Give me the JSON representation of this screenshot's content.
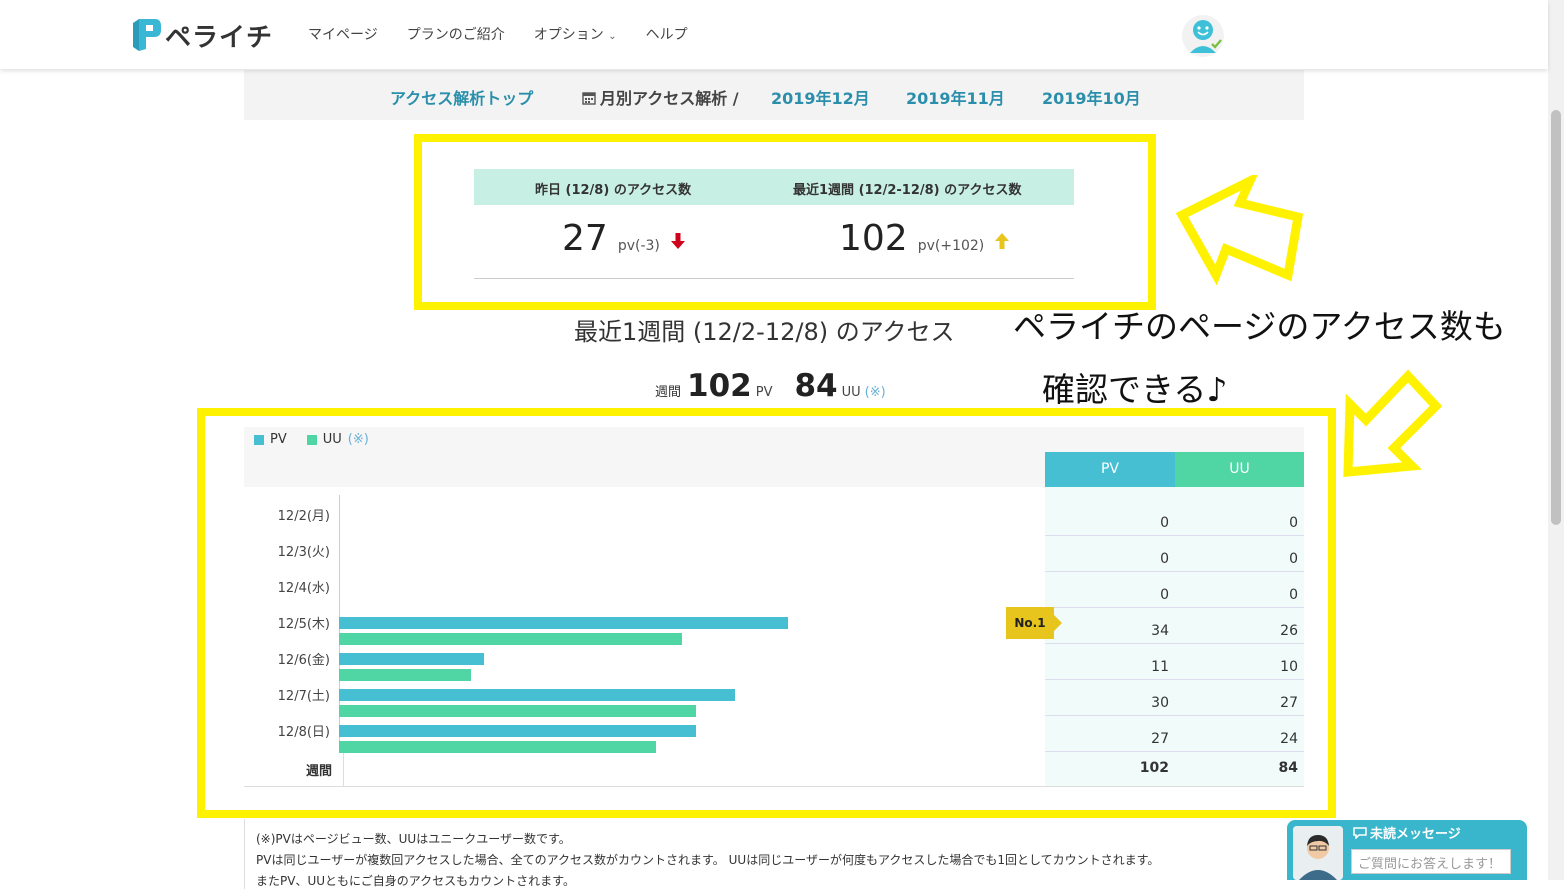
{
  "header": {
    "logo_text": "ペライチ",
    "nav": [
      "マイページ",
      "プランのご紹介",
      "オプション",
      "ヘルプ"
    ],
    "nav_chevron": "⌄"
  },
  "subnav": {
    "top": "アクセス解析トップ",
    "monthly_label": "月別アクセス解析 /",
    "months": [
      "2019年12月",
      "2019年11月",
      "2019年10月"
    ]
  },
  "stats": {
    "yesterday_label": "昨日 (12/8) のアクセス数",
    "yesterday_value": "27",
    "yesterday_delta": "pv(-3)",
    "week_label": "最近1週間 (12/2-12/8) のアクセス数",
    "week_value": "102",
    "week_delta": "pv(+102)"
  },
  "week_title": "最近1週間 (12/2-12/8) のアクセス",
  "week_summary": {
    "label": "週間",
    "pv": "102",
    "pv_unit": "PV",
    "uu": "84",
    "uu_unit": "UU",
    "note": "(※)"
  },
  "annotation": {
    "line1": "ペライチのページのアクセス数も",
    "line2": "確認できる♪"
  },
  "legend": {
    "pv": "PV",
    "uu": "UU",
    "note": "(※)"
  },
  "table_headers": {
    "pv": "PV",
    "uu": "UU"
  },
  "chart_data": {
    "type": "bar",
    "categories": [
      "12/2(月)",
      "12/3(火)",
      "12/4(水)",
      "12/5(木)",
      "12/6(金)",
      "12/7(土)",
      "12/8(日)"
    ],
    "series": [
      {
        "name": "PV",
        "values": [
          0,
          0,
          0,
          34,
          11,
          30,
          27
        ]
      },
      {
        "name": "UU",
        "values": [
          0,
          0,
          0,
          26,
          10,
          27,
          24
        ]
      }
    ],
    "xlim": [
      0,
      53
    ],
    "colors": {
      "PV": "#47bfd3",
      "UU": "#4fd6a4"
    }
  },
  "totals": {
    "label": "週間",
    "pv": "102",
    "uu": "84"
  },
  "badge": "No.1",
  "footnotes": [
    "(※)PVはページビュー数、UUはユニークユーザー数です。",
    "PVは同じユーザーが複数回アクセスした場合、全てのアクセス数がカウントされます。 UUは同じユーザーが何度もアクセスした場合でも1回としてカウントされます。",
    "またPV、UUともにご自身のアクセスもカウントされます。"
  ],
  "chat": {
    "title": "未読メッセージ",
    "placeholder": "ご質問にお答えします！"
  }
}
